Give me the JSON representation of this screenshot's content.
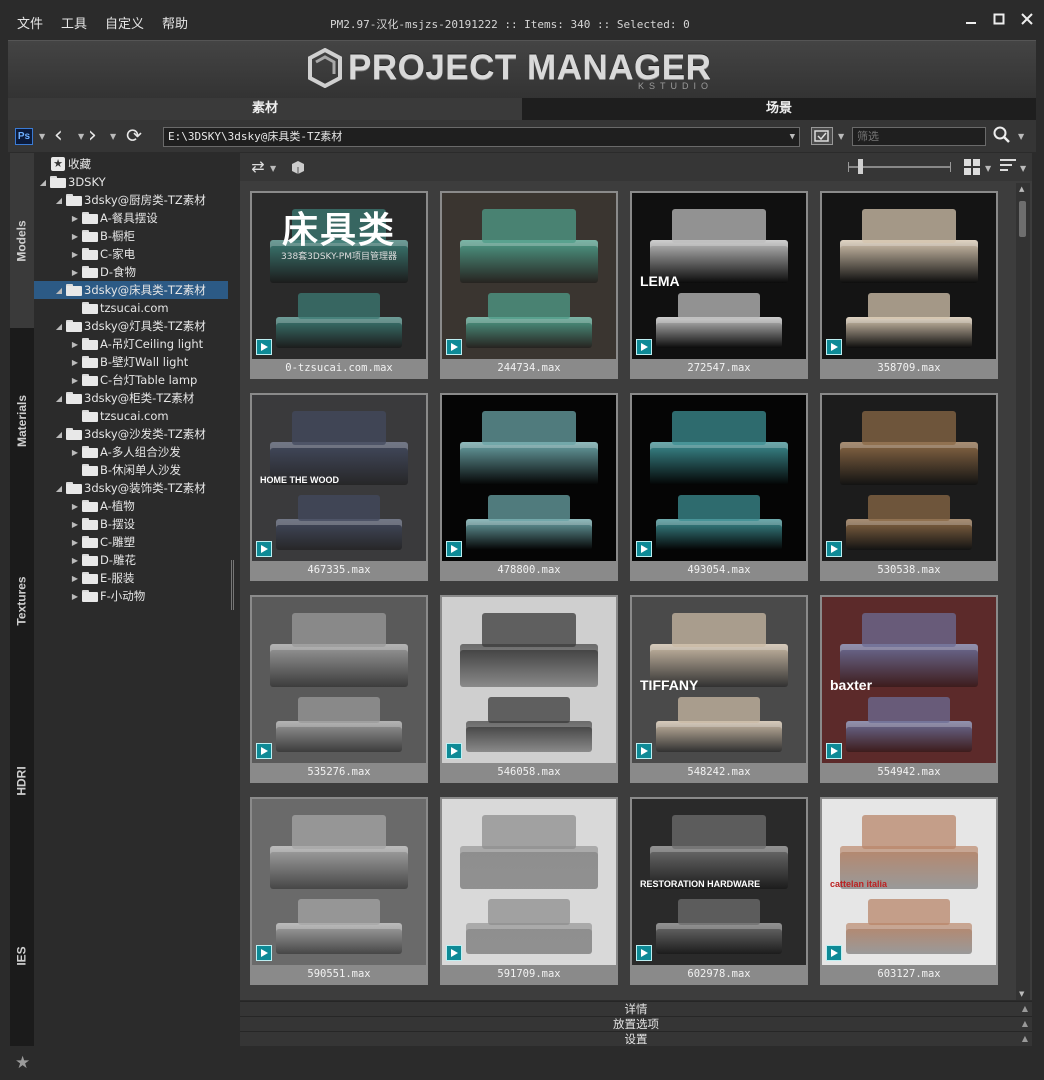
{
  "menu": [
    "文件",
    "工具",
    "自定义",
    "帮助"
  ],
  "window_title": "PM2.97-汉化-msjzs-20191222  :: Items: 340  :: Selected: 0",
  "logo": {
    "text": "PROJECT MANAGER",
    "sub": "KSTUDIO"
  },
  "main_tabs": [
    "素材",
    "场景"
  ],
  "toolbar": {
    "path": "E:\\3DSKY\\3dsky@床具类-TZ素材",
    "filter_placeholder": "筛选"
  },
  "side_tabs": [
    "Models",
    "Materials",
    "Textures",
    "HDRI",
    "IES"
  ],
  "tree": [
    {
      "label": "收藏",
      "level": 0,
      "type": "fav"
    },
    {
      "label": "3DSKY",
      "level": 0,
      "expander": "open"
    },
    {
      "label": "3dsky@厨房类-TZ素材",
      "level": 1,
      "expander": "open"
    },
    {
      "label": "A-餐具摆设",
      "level": 2,
      "expander": "closed"
    },
    {
      "label": "B-橱柜",
      "level": 2,
      "expander": "closed"
    },
    {
      "label": "C-家电",
      "level": 2,
      "expander": "closed"
    },
    {
      "label": "D-食物",
      "level": 2,
      "expander": "closed"
    },
    {
      "label": "3dsky@床具类-TZ素材",
      "level": 1,
      "expander": "open",
      "selected": true
    },
    {
      "label": "tzsucai.com",
      "level": 2,
      "expander": "none"
    },
    {
      "label": "3dsky@灯具类-TZ素材",
      "level": 1,
      "expander": "open"
    },
    {
      "label": "A-吊灯Ceiling light",
      "level": 2,
      "expander": "closed"
    },
    {
      "label": "B-壁灯Wall light",
      "level": 2,
      "expander": "closed"
    },
    {
      "label": "C-台灯Table lamp",
      "level": 2,
      "expander": "closed"
    },
    {
      "label": "3dsky@柜类-TZ素材",
      "level": 1,
      "expander": "open"
    },
    {
      "label": "tzsucai.com",
      "level": 2,
      "expander": "none"
    },
    {
      "label": "3dsky@沙发类-TZ素材",
      "level": 1,
      "expander": "open"
    },
    {
      "label": "A-多人组合沙发",
      "level": 2,
      "expander": "closed"
    },
    {
      "label": "B-休闲单人沙发",
      "level": 2,
      "expander": "none"
    },
    {
      "label": "3dsky@装饰类-TZ素材",
      "level": 1,
      "expander": "open"
    },
    {
      "label": "A-植物",
      "level": 2,
      "expander": "closed"
    },
    {
      "label": "B-摆设",
      "level": 2,
      "expander": "closed"
    },
    {
      "label": "C-雕塑",
      "level": 2,
      "expander": "closed"
    },
    {
      "label": "D-雕花",
      "level": 2,
      "expander": "closed"
    },
    {
      "label": "E-服装",
      "level": 2,
      "expander": "closed"
    },
    {
      "label": "F-小动物",
      "level": 2,
      "expander": "closed"
    }
  ],
  "items": [
    {
      "name": "0-tzsucai.com.max",
      "bg": "#2a2a2a",
      "bed": "#3c7b74",
      "title": "床具类",
      "subtitle": "338套3DSKY-PM项目管理器"
    },
    {
      "name": "244734.max",
      "bg": "#3a3530",
      "bed": "#4f9c88"
    },
    {
      "name": "272547.max",
      "bg": "#101010",
      "bed": "#bdbdbd",
      "brand": "LEMA"
    },
    {
      "name": "358709.max",
      "bg": "#141414",
      "bed": "#d4c4ae"
    },
    {
      "name": "467335.max",
      "bg": "#3a3a3c",
      "bed": "#434a5e",
      "brand": "HOME THE WOOD"
    },
    {
      "name": "478800.max",
      "bg": "#050505",
      "bed": "#6aa3a6"
    },
    {
      "name": "493054.max",
      "bg": "#050505",
      "bed": "#3c8d91"
    },
    {
      "name": "530538.max",
      "bg": "#1c1c1c",
      "bed": "#8a6845"
    },
    {
      "name": "535276.max",
      "bg": "#5a5a5a",
      "bed": "#9a9a9a"
    },
    {
      "name": "546058.max",
      "bg": "#cfcfcf",
      "bed": "#3a3a3a"
    },
    {
      "name": "548242.max",
      "bg": "#4a4a4a",
      "bed": "#c9b9a4",
      "brand": "TIFFANY"
    },
    {
      "name": "554942.max",
      "bg": "#5c2a2a",
      "bed": "#6c6c94",
      "brand": "baxter"
    },
    {
      "name": "590551.max",
      "bg": "#6a6a6a",
      "bed": "#a5a5a5"
    },
    {
      "name": "591709.max",
      "bg": "#d9d9d9",
      "bed": "#8e8e8e"
    },
    {
      "name": "602978.max",
      "bg": "#2a2a2a",
      "bed": "#6e6e6e",
      "brand": "RESTORATION HARDWARE"
    },
    {
      "name": "603127.max",
      "bg": "#e6e6e6",
      "bed": "#b8866a",
      "brand": "cattelan italia"
    }
  ],
  "bottom_sections": [
    "详情",
    "放置选项",
    "设置"
  ]
}
